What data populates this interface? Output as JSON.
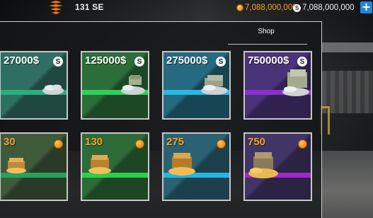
{
  "hud": {
    "car_name": "131 SE",
    "coins": "7,088,000,000",
    "cash": "7,088,000,000",
    "add_label": "+"
  },
  "shop": {
    "title": "Shop",
    "cash_packs": [
      {
        "price": "27000$",
        "bg": "#2f6f63",
        "stripe": "#28b07a"
      },
      {
        "price": "125000$",
        "bg": "#2b6e3a",
        "stripe": "#2fd05a"
      },
      {
        "price": "275000$",
        "bg": "#256a80",
        "stripe": "#27b8e6"
      },
      {
        "price": "750000$",
        "bg": "#4a3378",
        "stripe": "#8a2fd0"
      }
    ],
    "coin_packs": [
      {
        "amount": "30",
        "bg": "#3f5a3a",
        "stripe": "#28a060"
      },
      {
        "amount": "130",
        "bg": "#2d6b38",
        "stripe": "#2bd04f"
      },
      {
        "amount": "275",
        "bg": "#2a6274",
        "stripe": "#26b6e4"
      },
      {
        "amount": "750",
        "bg": "#403566",
        "stripe": "#a028c8"
      }
    ]
  },
  "colors": {
    "coin_orange": "#f5a623",
    "add_blue": "#1f86d9",
    "logo_orange": "#e8741c"
  },
  "icons": {
    "brand": "brand-logo-icon",
    "coin": "coin-icon",
    "cash": "s-coin-icon"
  }
}
